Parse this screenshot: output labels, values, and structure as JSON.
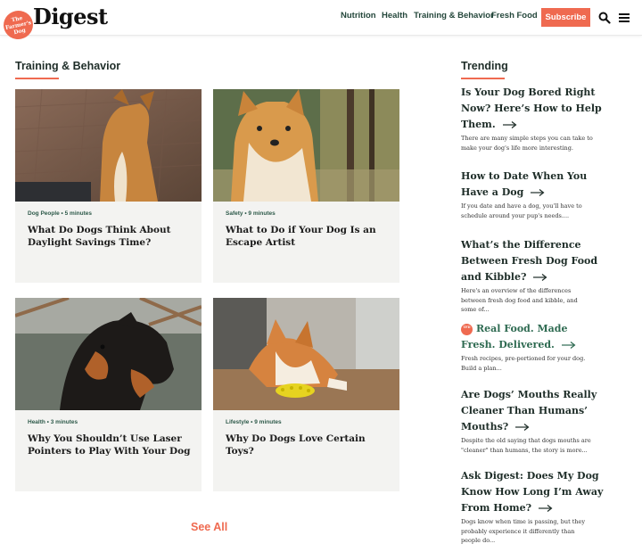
{
  "header": {
    "logo_badge": "The Farmer's Dog",
    "brand": "Digest",
    "nav": [
      "Nutrition",
      "Health",
      "Training & Behavior",
      "Fresh Food"
    ],
    "subscribe": "Subscribe",
    "icons": [
      "search-icon",
      "menu-icon"
    ]
  },
  "main": {
    "section_title": "Training & Behavior",
    "cards": [
      {
        "meta": "Dog People • 5 minutes",
        "title": "What Do Dogs Think About Daylight Savings Time?",
        "image": "small-dog-sunlight-photo"
      },
      {
        "meta": "Safety • 9 minutes",
        "title": "What to Do if Your Dog Is an Escape Artist",
        "image": "shiba-inu-photo"
      },
      {
        "meta": "Health • 3 minutes",
        "title": "Why You Shouldn’t Use Laser Pointers to Play With Your Dog",
        "image": "rottweiler-photo"
      },
      {
        "meta": "Lifestyle • 9 minutes",
        "title": "Why Do Dogs Love Certain Toys?",
        "image": "corgi-toy-photo"
      }
    ],
    "see_all": "See All"
  },
  "trending": {
    "title": "Trending",
    "items": [
      {
        "title": "Is Your Dog Bored Right Now? Here’s How to Help Them.",
        "desc": "There are many simple steps you can take to make your dog's life more interesting."
      },
      {
        "title": "How to Date When You Have a Dog",
        "desc": "If you date and have a dog, you'll have to schedule around your pup's needs...."
      },
      {
        "title": "What’s the Difference Between Fresh Dog Food and Kibble?",
        "desc": "Here's an overview of the differences between fresh dog food and kibble, and some of..."
      },
      {
        "title": "Real Food. Made Fresh. Delivered.",
        "desc": "Fresh recipes, pre-portioned for your dog. Build a plan..."
      },
      {
        "title": "Are Dogs’ Mouths Really Cleaner Than Humans’ Mouths?",
        "desc": "Despite the old saying that dogs mouths are \"cleaner\" than humans, the story is more..."
      },
      {
        "title": "Ask Digest: Does My Dog Know How Long I’m Away From Home?",
        "desc": "Dogs know when time is passing, but they probably experience it differently than people do..."
      }
    ]
  },
  "colors": {
    "accent": "#ef6a50",
    "nav_green": "#24473b",
    "card_bg": "#f3f3f1"
  }
}
